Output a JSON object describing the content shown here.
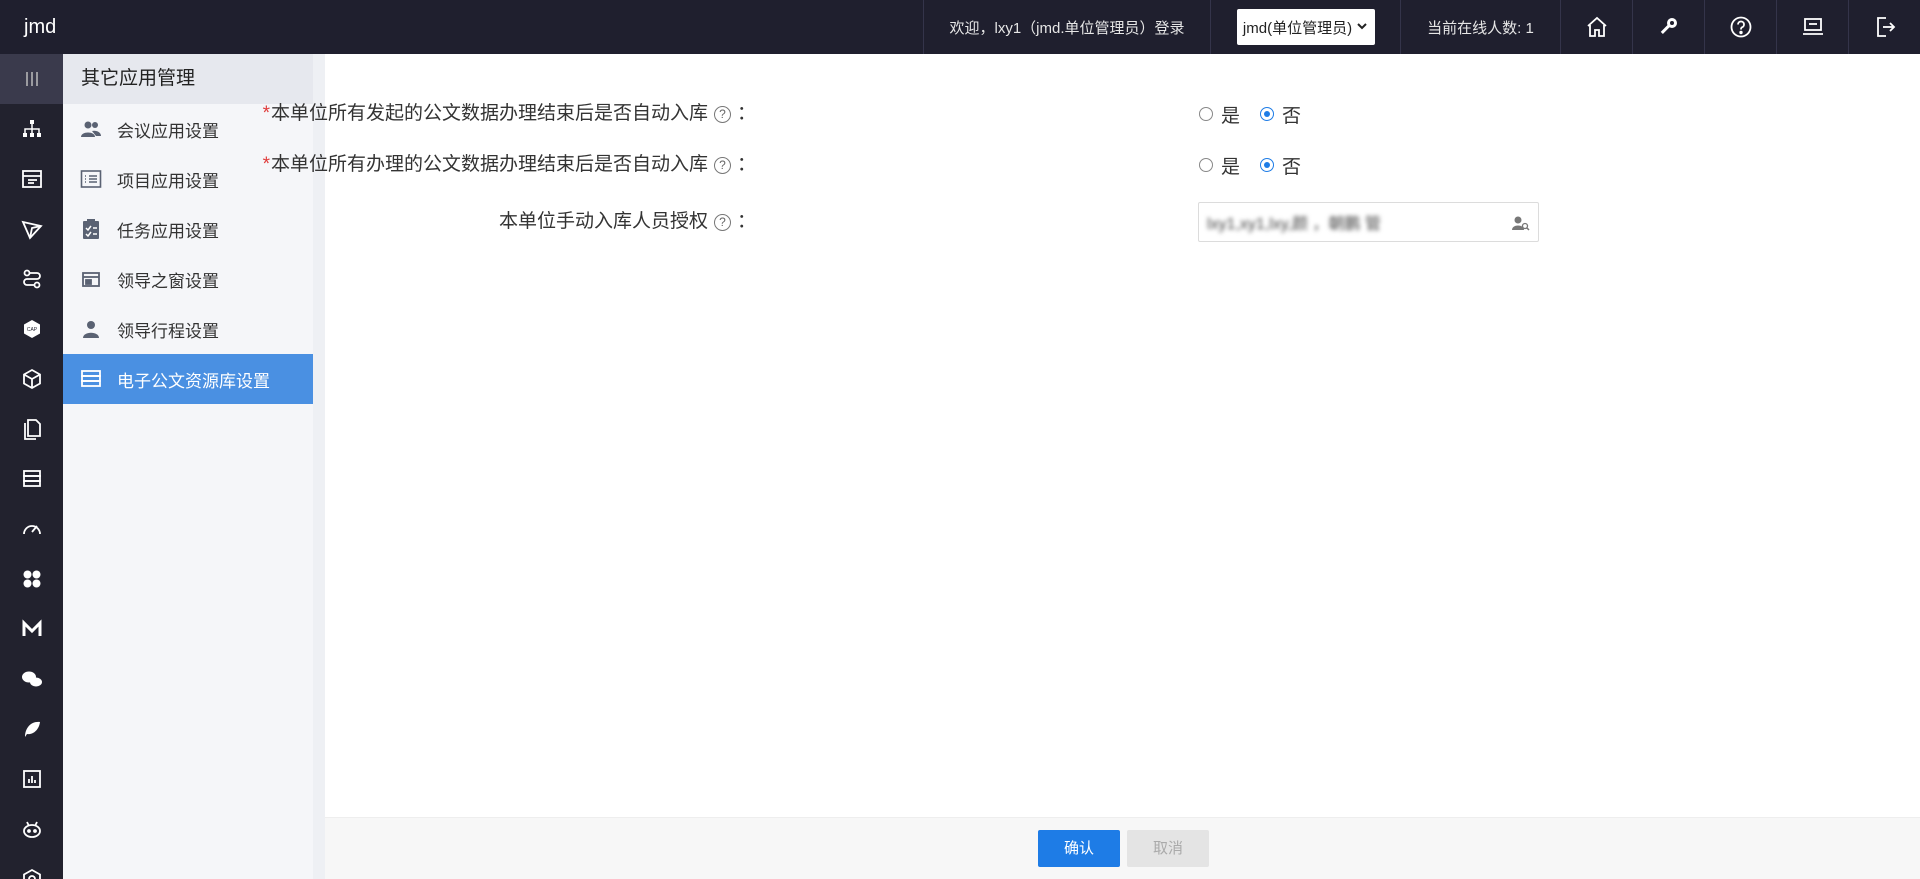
{
  "app": {
    "brand": "jmd"
  },
  "header": {
    "welcome": "欢迎，lxy1（jmd.单位管理员）登录",
    "role_selected": "jmd(单位管理员)",
    "online": "当前在线人数: 1",
    "icons": [
      "home-icon",
      "key-icon",
      "help-icon",
      "monitor-icon",
      "logout-icon"
    ]
  },
  "rail": {
    "icons": [
      "menu-toggle-icon",
      "org-chart-icon",
      "table-icon",
      "send-icon",
      "flow-icon",
      "cap-icon",
      "cube-icon",
      "document-icon",
      "stack-icon",
      "speed-icon",
      "apps-icon",
      "m-icon",
      "wechat-icon",
      "feather-icon",
      "chart-icon",
      "robot-icon",
      "settings-hex-icon"
    ]
  },
  "submenu": {
    "title": "其它应用管理",
    "items": [
      {
        "label": "会议应用设置",
        "icon": "meeting-icon"
      },
      {
        "label": "项目应用设置",
        "icon": "list-icon"
      },
      {
        "label": "任务应用设置",
        "icon": "clipboard-icon"
      },
      {
        "label": "领导之窗设置",
        "icon": "window-icon"
      },
      {
        "label": "领导行程设置",
        "icon": "person-icon"
      },
      {
        "label": "电子公文资源库设置",
        "icon": "database-icon"
      }
    ]
  },
  "form": {
    "q1": {
      "required_mark": "*",
      "label": "本单位所有发起的公文数据办理结束后是否自动入库",
      "colon": "：",
      "yes": "是",
      "no": "否",
      "selected": "否"
    },
    "q2": {
      "required_mark": "*",
      "label": "本单位所有办理的公文数据办理结束后是否自动入库",
      "colon": "：",
      "yes": "是",
      "no": "否",
      "selected": "否"
    },
    "q3": {
      "label": "本单位手动入库人员授权",
      "colon": "：",
      "value": "lxy1,xy1,lxy,颜 ，朝鹏 管"
    },
    "help_glyph": "?"
  },
  "footer": {
    "ok": "确认",
    "cancel": "取消"
  },
  "colors": {
    "topbar": "#1f1f2e",
    "rail": "#22222e",
    "active": "#4a90e2",
    "primary": "#1e7ce6",
    "required": "#e03b3b"
  }
}
